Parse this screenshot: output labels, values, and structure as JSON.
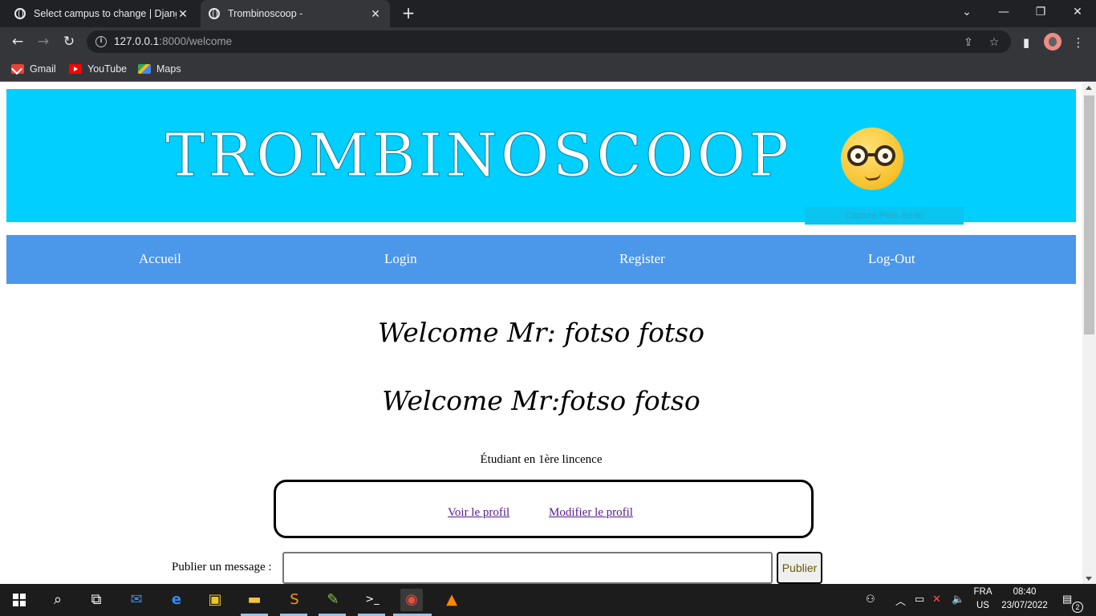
{
  "browser": {
    "tabs": [
      {
        "title": "Select campus to change | Django",
        "active": false
      },
      {
        "title": "Trombinoscoop -",
        "active": true
      }
    ],
    "new_tab_label": "+",
    "url_host": "127.0.0.1",
    "url_rest": ":8000/welcome",
    "bookmarks": [
      {
        "label": "Gmail",
        "icon": "gmail-icon"
      },
      {
        "label": "YouTube",
        "icon": "youtube-icon"
      },
      {
        "label": "Maps",
        "icon": "maps-icon"
      }
    ]
  },
  "page": {
    "banner_title": "TROMBINOSCOOP",
    "banner_emoji": "nerd-face-icon",
    "capture_hint": "Capture Plein écran",
    "nav": [
      "Accueil",
      "Login",
      "Register",
      "Log-Out"
    ],
    "welcome_1": "Welcome Mr: fotso fotso",
    "welcome_2": "Welcome Mr:fotso fotso",
    "status": "Étudiant en 1ère lincence",
    "links": {
      "view_profile": "Voir le profil",
      "edit_profile": "Modifier le profil"
    },
    "post_label": "Publier un message :",
    "post_value": "",
    "post_button": "Publier"
  },
  "taskbar": {
    "language": "FRA",
    "layout": "US",
    "time": "08:40",
    "date": "23/07/2022",
    "notifications": "2"
  },
  "colors": {
    "banner": "#00cfff",
    "nav": "#4b97ea",
    "link": "#551a8b"
  }
}
